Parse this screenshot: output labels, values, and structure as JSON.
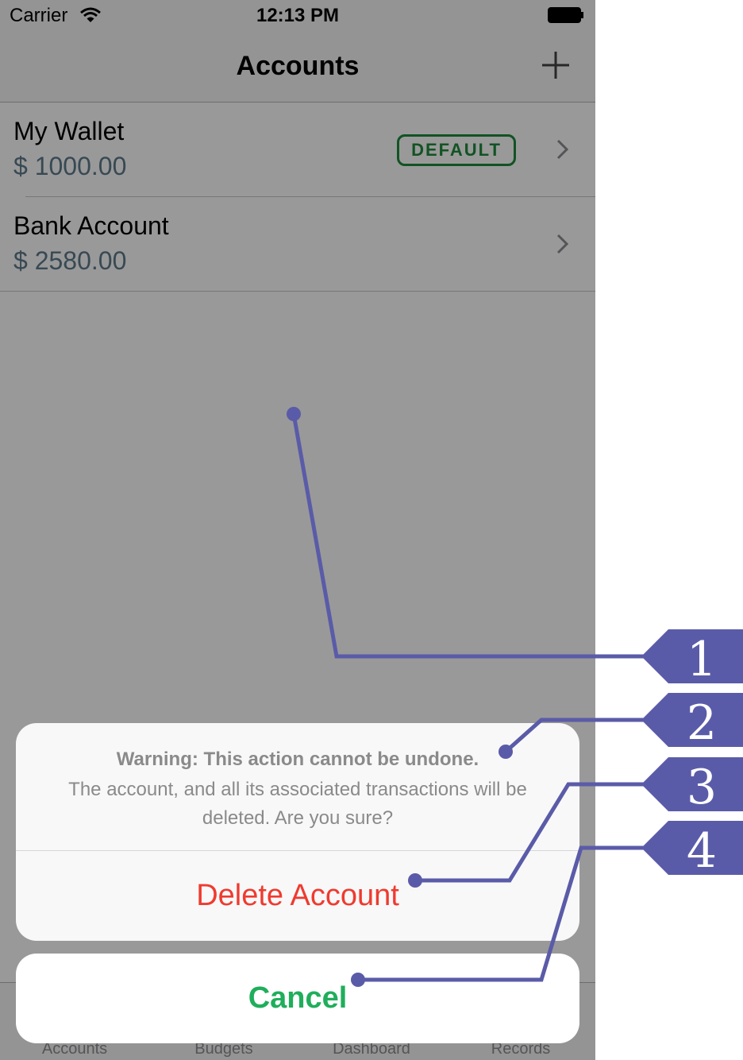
{
  "status_bar": {
    "carrier": "Carrier",
    "time": "12:13 PM"
  },
  "nav_bar": {
    "title": "Accounts"
  },
  "accounts": [
    {
      "name": "My Wallet",
      "amount": "$ 1000.00",
      "badge": "DEFAULT"
    },
    {
      "name": "Bank Account",
      "amount": "$ 2580.00"
    }
  ],
  "tab_bar": {
    "tabs": [
      "Accounts",
      "Budgets",
      "Dashboard",
      "Records"
    ]
  },
  "action_sheet": {
    "title": "Warning: This action cannot be undone.",
    "message": "The account, and all its associated transactions will be deleted. Are you sure?",
    "delete_label": "Delete Account",
    "cancel_label": "Cancel"
  },
  "callouts": [
    "1",
    "2",
    "3",
    "4"
  ],
  "colors": {
    "callout": "#5a5ba8",
    "destructive": "#f03a2f",
    "cancel": "#1fae5b",
    "badge": "#1e8a3c",
    "amount": "#5e7a8a"
  }
}
